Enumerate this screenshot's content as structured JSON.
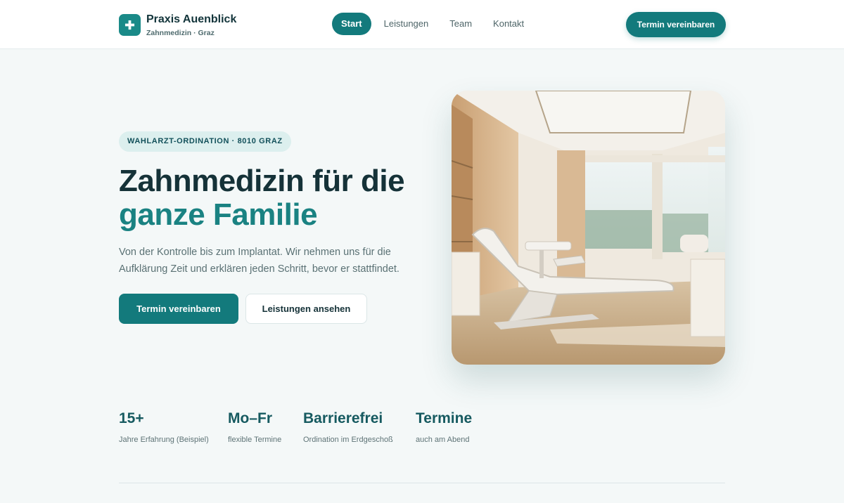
{
  "header": {
    "brand_name": "Praxis Auenblick",
    "brand_sub": "Zahnmedizin · Graz",
    "logo_icon": "medical-cross-icon",
    "nav": [
      {
        "label": "Start",
        "active": true
      },
      {
        "label": "Leistungen",
        "active": false
      },
      {
        "label": "Team",
        "active": false
      },
      {
        "label": "Kontakt",
        "active": false
      }
    ],
    "cta_label": "Termin vereinbaren"
  },
  "hero": {
    "badge": "WAHLARZT-ORDINATION · 8010 GRAZ",
    "headline_line1": "Zahnmedizin für die",
    "headline_line2": "ganze Familie",
    "lead": "Von der Kontrolle bis zum Implantat. Wir nehmen uns für die Aufklärung Zeit und erklären jeden Schritt, bevor er stattfindet.",
    "primary_button": "Termin vereinbaren",
    "secondary_button": "Leistungen ansehen"
  },
  "stats": [
    {
      "value": "15+",
      "label": "Jahre Erfahrung (Beispiel)"
    },
    {
      "value": "Mo–Fr",
      "label": "flexible Termine"
    },
    {
      "value": "Barrierefrei",
      "label": "Ordination im Erdgeschoß"
    },
    {
      "value": "Termine",
      "label": "auch am Abend"
    }
  ],
  "colors": {
    "accent": "#137a7c",
    "headline_accent": "#1a8282",
    "background": "#f4f8f8",
    "text_dark": "#153238"
  }
}
